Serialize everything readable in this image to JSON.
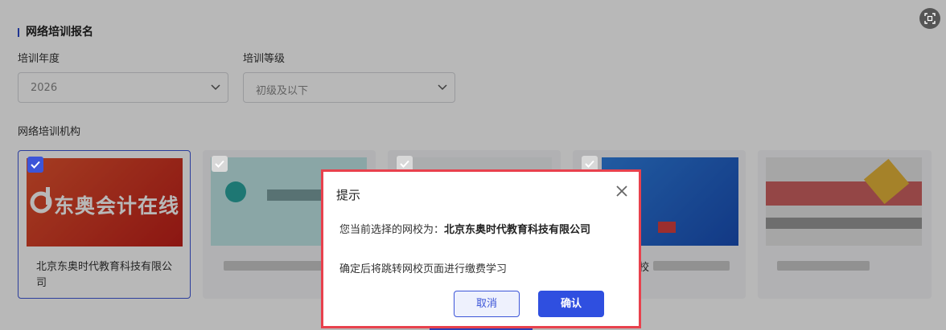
{
  "section": {
    "title": "网络培训报名"
  },
  "year": {
    "label": "培训年度",
    "value": "2026"
  },
  "level": {
    "label": "培训等级",
    "value": "初级及以下"
  },
  "institutions": {
    "label": "网络培训机构",
    "cards": [
      {
        "logo_text": "东奥会计在线",
        "name": "北京东奥时代教育科技有限公司",
        "selected": true
      },
      {
        "selected": false
      },
      {
        "selected": false
      },
      {
        "name_fragment": "校",
        "selected": false
      },
      {
        "selected": false
      }
    ]
  },
  "dialog": {
    "title": "提示",
    "message_prefix": "您当前选择的网校为：",
    "school_name": "北京东奥时代教育科技有限公司",
    "message2": "确定后将跳转网校页面进行缴费学习",
    "cancel_label": "取消",
    "confirm_label": "确认"
  },
  "colors": {
    "accent": "#2f4fe0",
    "highlight": "#e8414d"
  }
}
